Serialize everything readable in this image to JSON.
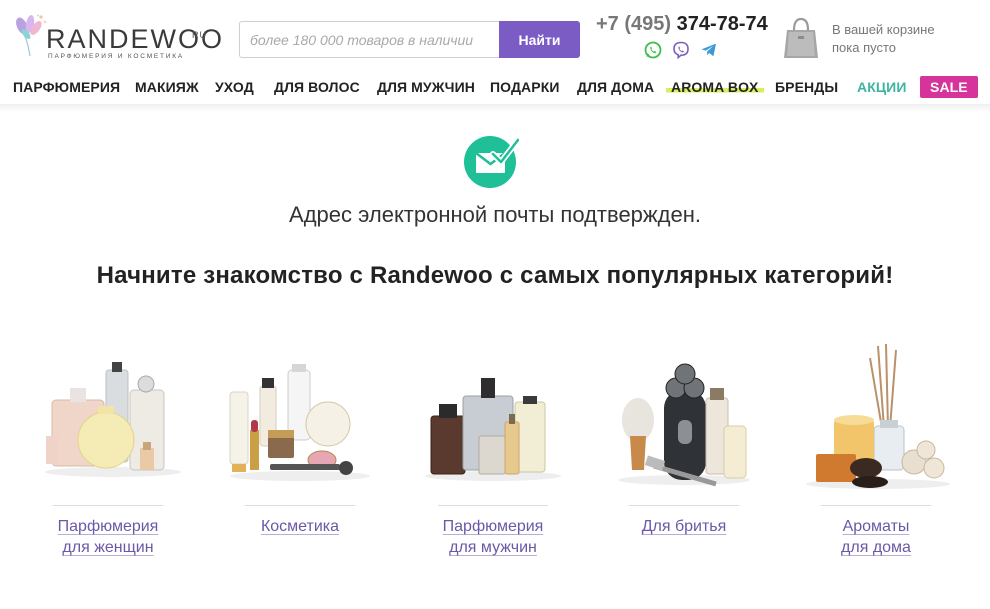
{
  "brand": {
    "name": "RANDEWOO",
    "tld": "RU",
    "tagline": "парфюмерия и косметика"
  },
  "search": {
    "placeholder": "более 180 000 товаров в наличии",
    "value": "",
    "button_label": "Найти"
  },
  "contacts": {
    "phone_code": "+7 (495)",
    "phone_number": "374-78-74",
    "messengers": [
      "whatsapp-icon",
      "viber-icon",
      "telegram-icon"
    ]
  },
  "cart": {
    "line1": "В вашей корзине",
    "line2": "пока пусто"
  },
  "nav": {
    "items": [
      {
        "label": "ПАРФЮМЕРИЯ"
      },
      {
        "label": "МАКИЯЖ"
      },
      {
        "label": "УХОД"
      },
      {
        "label": "ДЛЯ ВОЛОС"
      },
      {
        "label": "ДЛЯ МУЖЧИН"
      },
      {
        "label": "ПОДАРКИ"
      },
      {
        "label": "ДЛЯ ДОМА"
      },
      {
        "label": "AROMA BOX"
      },
      {
        "label": "БРЕНДЫ"
      },
      {
        "label": "АКЦИИ"
      },
      {
        "label": "SALE"
      }
    ]
  },
  "confirmation": {
    "message": "Адрес электронной почты подтвержден.",
    "headline": "Начните знакомство с Randewoo с самых популярных категорий!"
  },
  "categories": [
    {
      "line1": "Парфюмерия",
      "line2": "для женщин"
    },
    {
      "line1": "Косметика",
      "line2": ""
    },
    {
      "line1": "Парфюмерия",
      "line2": "для мужчин"
    },
    {
      "line1": "Для бритья",
      "line2": ""
    },
    {
      "line1": "Ароматы",
      "line2": "для дома"
    }
  ],
  "colors": {
    "accent": "#7b5cc4",
    "link": "#6b58a8",
    "success": "#1fbf98",
    "sale": "#d6339b",
    "promo": "#3fb5a0",
    "aroma_highlight": "#d8ee5c"
  }
}
